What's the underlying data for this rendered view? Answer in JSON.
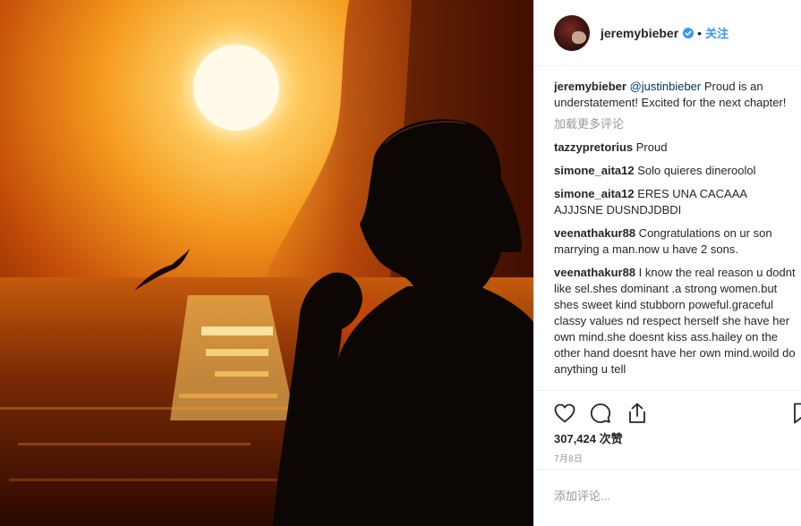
{
  "post": {
    "username": "jeremybieber",
    "follow_label": "关注",
    "dot": "•",
    "caption": {
      "user": "jeremybieber",
      "mention": "@justinbieber",
      "text": " Proud is an understatement! Excited for the next chapter!"
    },
    "load_more_label": "加载更多评论",
    "comments": [
      {
        "user": "tazzypretorius",
        "text": " Proud"
      },
      {
        "user": "simone_aita12",
        "text": " Solo quieres dineroolol"
      },
      {
        "user": "simone_aita12",
        "text": " ERES UNA CACAAA AJJJSNE DUSNDJDBDI"
      },
      {
        "user": "veenathakur88",
        "text": " Congratulations on ur son marrying a man.now u have 2 sons."
      },
      {
        "user": "veenathakur88",
        "text": " I know the real reason u dodnt like sel.shes dominant .a strong women.but shes sweet kind stubborn poweful.graceful classy values nd respect herself she have her own mind.she doesnt kiss ass.hailey on the other hand doesnt have her own mind.woild do anything u tell"
      }
    ],
    "likes_label": "307,424 次赞",
    "date_label": "7月8日",
    "add_comment_placeholder": "添加评论...",
    "icons": {
      "like": "heart-icon",
      "comment": "speech-bubble-icon",
      "share": "share-icon",
      "save": "bookmark-icon",
      "verified": "verified-badge-icon"
    },
    "colors": {
      "accent": "#3897f0",
      "text": "#262626",
      "muted": "#999999",
      "divider": "#efefef"
    }
  }
}
